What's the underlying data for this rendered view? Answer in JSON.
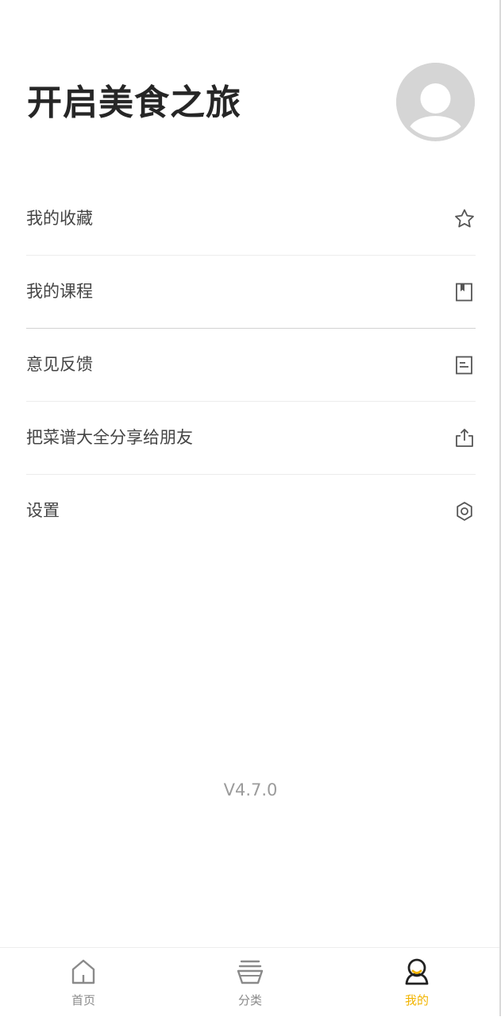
{
  "header": {
    "title": "开启美食之旅"
  },
  "menu": {
    "items": [
      {
        "label": "我的收藏",
        "icon": "star-icon"
      },
      {
        "label": "我的课程",
        "icon": "bookmark-book-icon"
      },
      {
        "label": "意见反馈",
        "icon": "feedback-note-icon"
      },
      {
        "label": "把菜谱大全分享给朋友",
        "icon": "share-icon"
      },
      {
        "label": "设置",
        "icon": "gear-icon"
      }
    ]
  },
  "version": "V4.7.0",
  "tabbar": {
    "tabs": [
      {
        "label": "首页",
        "icon": "home-icon",
        "active": false
      },
      {
        "label": "分类",
        "icon": "bowl-icon",
        "active": false
      },
      {
        "label": "我的",
        "icon": "profile-icon",
        "active": true
      }
    ]
  },
  "colors": {
    "accent": "#f2b400",
    "text": "#444444",
    "muted": "#8a8a8a",
    "divider": "#ececec"
  }
}
